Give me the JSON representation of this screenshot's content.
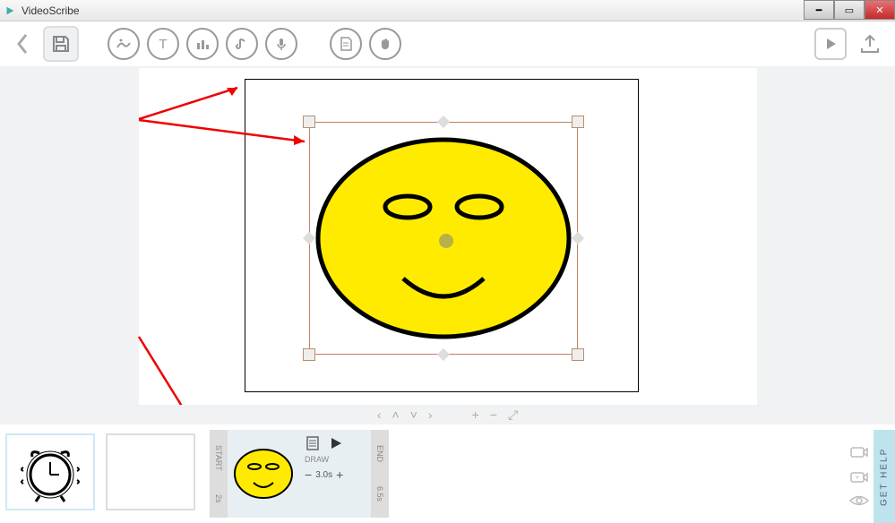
{
  "window": {
    "title": "VideoScribe"
  },
  "toolbar": {
    "back": "Back",
    "save": "Save",
    "image": "Add image",
    "text": "Add text",
    "chart": "Add chart",
    "music": "Add music",
    "voice": "Record voiceover",
    "page": "Page",
    "hand": "Hand",
    "play": "Preview",
    "export": "Export"
  },
  "nav": {
    "left": "‹",
    "up": "˄",
    "down": "˅",
    "right": "›",
    "plus": "+",
    "minus": "−",
    "expand": "⤢"
  },
  "element": {
    "start_label": "START",
    "start_time": "2s",
    "mode": "DRAW",
    "duration": "3.0s",
    "end_label": "END",
    "end_time": "6.5s",
    "minus": "−",
    "plus": "+"
  },
  "help": {
    "label": "GET HELP"
  }
}
